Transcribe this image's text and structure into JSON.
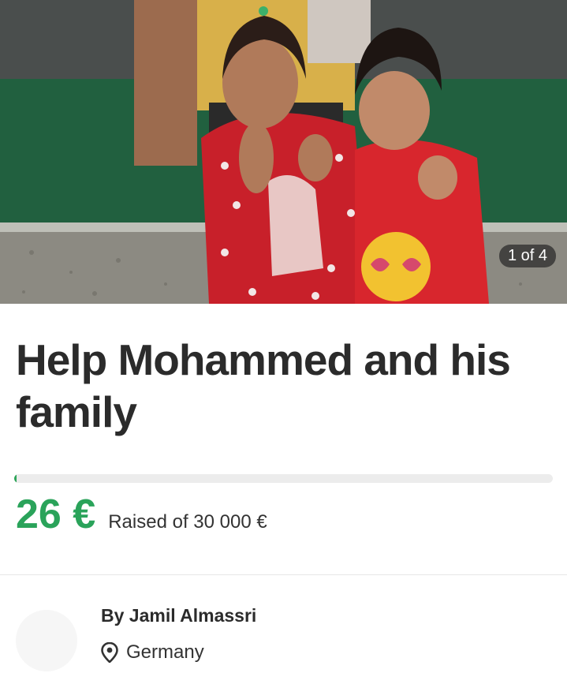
{
  "hero": {
    "image_alt": "Two girls giving thumbs up",
    "counter": "1 of 4"
  },
  "campaign": {
    "title": "Help Mohammed and his family",
    "raised_amount": "26 €",
    "raised_text": "Raised of 30 000 €",
    "progress_fraction": 0.00087
  },
  "organizer": {
    "name": "By Jamil Almassri",
    "location": "Germany"
  },
  "colors": {
    "accent_green": "#2aa35a",
    "progress_track": "#ececec"
  },
  "icons": {
    "location": "map-pin-icon"
  }
}
